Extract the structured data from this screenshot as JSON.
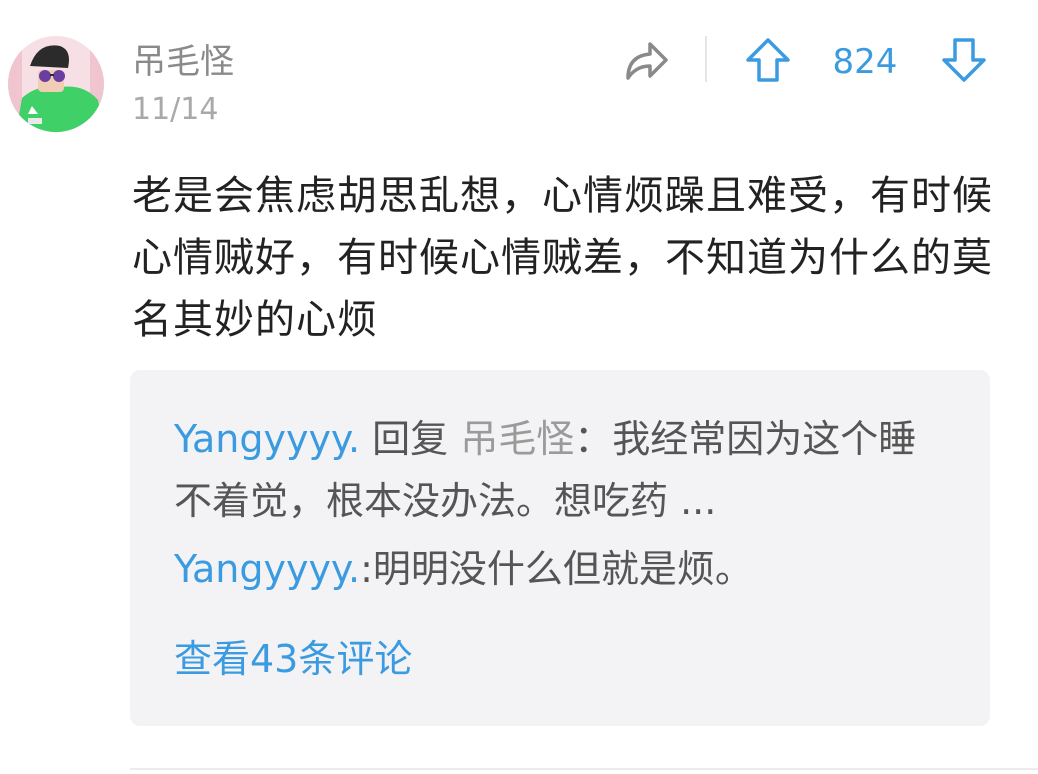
{
  "comment": {
    "username": "吊毛怪",
    "date": "11/14",
    "vote_count": "824",
    "body": "老是会焦虑胡思乱想，心情烦躁且难受，有时候心情贼好，有时候心情贼差，不知道为什么的莫名其妙的心烦"
  },
  "replies": {
    "items": [
      {
        "author": "Yangyyyy.",
        "reply_word": " 回复 ",
        "target": "吊毛怪",
        "text": "：我经常因为这个睡不着觉，根本没办法。想吃药 ..."
      },
      {
        "author": "Yangyyyy.",
        "text": ":明明没什么但就是烦。"
      }
    ],
    "view_more": "查看43条评论"
  },
  "icons": {
    "share": "share-icon",
    "upvote": "arrow-up-icon",
    "downvote": "arrow-down-icon"
  },
  "colors": {
    "accent": "#3b9be0",
    "avatar_bg": "#3fd068"
  }
}
